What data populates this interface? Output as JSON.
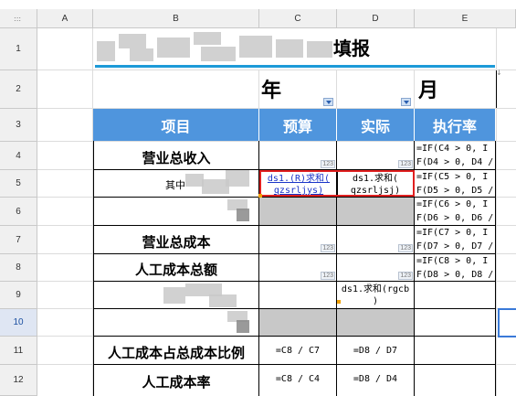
{
  "columns": [
    "A",
    "B",
    "C",
    "D",
    "E"
  ],
  "rows": [
    "1",
    "2",
    "3",
    "4",
    "5",
    "6",
    "7",
    "8",
    "9",
    "10",
    "11",
    "12"
  ],
  "corner_label": ":::",
  "title_suffix": "填报",
  "row2": {
    "year": "年",
    "month": "月"
  },
  "headers": {
    "item": "项目",
    "budget": "预算",
    "actual": "实际",
    "rate": "执行率"
  },
  "labels": {
    "r4": "营业总收入",
    "r5": "其中",
    "r7": "营业总成本",
    "r8": "人工成本总额",
    "r11": "人工成本占总成本比例",
    "r12": "人工成本率"
  },
  "badge": "123",
  "formulas": {
    "e4": [
      "=IF(C4 > 0, I",
      "F(D4 > 0, D4 /"
    ],
    "e5": [
      "=IF(C5 > 0, I",
      "F(D5 > 0, D5 /"
    ],
    "e6": [
      "=IF(C6 > 0, I",
      "F(D6 > 0, D6 /"
    ],
    "e7": [
      "=IF(C7 > 0, I",
      "F(D7 > 0, D7 /"
    ],
    "e8": [
      "=IF(C8 > 0, I",
      "F(D8 > 0, D8 /"
    ]
  },
  "c5": [
    "ds1.(R)求和(",
    "qzsrljys)"
  ],
  "d5": [
    "ds1.求和(",
    "qzsrljsj)"
  ],
  "d9": [
    "ds1.求和(rgcb",
    ")"
  ],
  "c11": "=C8 / C7",
  "d11": "=D8 / D7",
  "c12": "=C8 / C4",
  "d12": "=D8 / D4"
}
